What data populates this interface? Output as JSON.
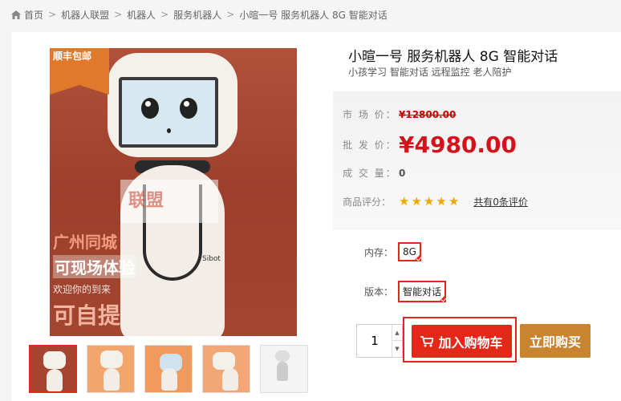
{
  "breadcrumb": {
    "items": [
      "首页",
      "机器人联盟",
      "机器人",
      "服务机器人",
      "小暄一号 服务机器人 8G 智能对话"
    ],
    "separator": ">"
  },
  "product": {
    "title": "小暄一号 服务机器人 8G 智能对话",
    "subtitle": "小孩学习 智能对话 远程监控 老人陪护"
  },
  "image": {
    "promo_tag": "顺丰包邮",
    "watermark": "联盟",
    "overlay_lines": [
      "广州同城",
      "可现场体验",
      "欢迎你的到来",
      "可自提"
    ],
    "robot_brand": "Sibot"
  },
  "thumbnails": {
    "count": 5,
    "active_index": 0
  },
  "price": {
    "market_label": "市 场 价：",
    "market_value": "¥12800.00",
    "wholesale_label": "批 发 价：",
    "wholesale_value": "¥4980.00",
    "volume_label": "成 交 量：",
    "volume_value": "0",
    "rating_label": "商品评分：",
    "rating_stars": 5,
    "reviews_link": "共有0条评价"
  },
  "options": {
    "memory_label": "内存：",
    "memory_value": "8G",
    "version_label": "版本：",
    "version_value": "智能对话"
  },
  "quantity": {
    "value": "1"
  },
  "buttons": {
    "add_to_cart": "加入购物车",
    "buy_now": "立即购买"
  },
  "colors": {
    "accent_red": "#e3281a",
    "price_red": "#d4121a",
    "buy_orange": "#c8842e",
    "star_yellow": "#f0a800"
  }
}
